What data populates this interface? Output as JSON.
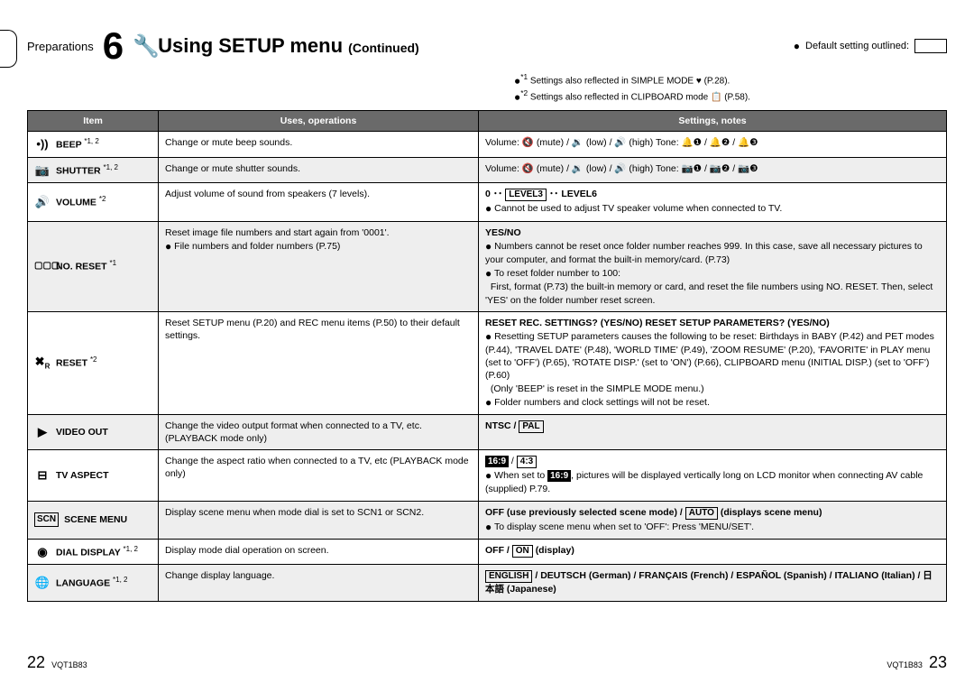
{
  "header": {
    "preparations": "Preparations",
    "number": "6",
    "title_main": "Using SETUP menu",
    "title_sub": "(Continued)",
    "default_setting": "Default setting outlined:"
  },
  "top_notes": {
    "n1_sup": "*1",
    "n1": "Settings also reflected in SIMPLE MODE ♥ (P.28).",
    "n2_sup": "*2",
    "n2": "Settings also reflected in CLIPBOARD mode 📋 (P.58)."
  },
  "columns": {
    "item": "Item",
    "uses": "Uses, operations",
    "settings": "Settings, notes"
  },
  "rows": {
    "beep": {
      "label": "BEEP",
      "sup": "*1, 2",
      "uses": "Change or mute beep sounds.",
      "settings": "Volume: 🔇 (mute) / 🔉 (low) / 🔊 (high)    Tone: 🔔❶ / 🔔❷ / 🔔❸"
    },
    "shutter": {
      "label": "SHUTTER",
      "sup": "*1, 2",
      "uses": "Change or mute shutter sounds.",
      "settings": "Volume: 🔇 (mute) / 🔉 (low) / 🔊 (high)    Tone: 📷❶ / 📷❷ / 📷❸"
    },
    "volume": {
      "label": "VOLUME",
      "sup": "*2",
      "uses": "Adjust volume of sound from speakers (7 levels).",
      "set_l": "0 ･･",
      "set_box": "LEVEL3",
      "set_r": "･･ LEVEL6",
      "bul": "Cannot be used to adjust TV speaker volume when connected to TV."
    },
    "noreset": {
      "label": "NO. RESET",
      "sup": "*1",
      "u1": "Reset image file numbers and start again from '0001'.",
      "u2": "File numbers and folder numbers (P.75)",
      "yesno": "YES/NO",
      "b1": "Numbers cannot be reset once folder number reaches 999. In this case, save all necessary pictures to your computer, and format the built-in memory/card. (P.73)",
      "b2": "To reset folder number to 100:",
      "b2a": "First, format (P.73) the built-in memory or card, and reset the file numbers using NO. RESET. Then, select 'YES' on the folder number reset screen."
    },
    "reset": {
      "label": "RESET",
      "sup": "*2",
      "uses": "Reset SETUP menu (P.20) and REC menu items (P.50) to their default settings.",
      "h": "RESET REC. SETTINGS? (YES/NO)    RESET SETUP PARAMETERS? (YES/NO)",
      "b1": "Resetting SETUP parameters causes the following to be reset: Birthdays in BABY (P.42) and PET modes (P.44), 'TRAVEL DATE' (P.48), 'WORLD TIME' (P.49), 'ZOOM RESUME' (P.20), 'FAVORITE' in PLAY menu (set to 'OFF') (P.65), 'ROTATE DISP.' (set to 'ON') (P.66), CLIPBOARD menu (INITIAL DISP.) (set to 'OFF') (P.60)",
      "b1a": "(Only 'BEEP' is reset in the SIMPLE MODE menu.)",
      "b2": "Folder numbers and clock settings will not be reset."
    },
    "videoout": {
      "label": "VIDEO OUT",
      "uses": "Change the video output format when connected to a TV, etc. (PLAYBACK mode only)",
      "set_l": "NTSC /",
      "set_box": "PAL"
    },
    "tvaspect": {
      "label": "TV ASPECT",
      "uses": "Change the aspect ratio when connected to a TV, etc (PLAYBACK mode only)",
      "a169": "16:9",
      "a43": "4:3",
      "b1a": "When set to ",
      "b1b": ", pictures will be displayed vertically long on LCD monitor when connecting AV cable (supplied) P.79."
    },
    "scene": {
      "label": "SCENE MENU",
      "uses": "Display scene menu when mode dial is set to SCN1 or SCN2.",
      "set_l": "OFF (use previously selected scene mode) /",
      "set_box": "AUTO",
      "set_r": "(displays scene menu)",
      "b1": "To display scene menu when set to 'OFF': Press 'MENU/SET'."
    },
    "dial": {
      "label": "DIAL DISPLAY",
      "sup": "*1, 2",
      "uses": "Display mode dial operation on screen.",
      "set_l": "OFF /",
      "set_box": "ON",
      "set_r": "(display)"
    },
    "lang": {
      "label": "LANGUAGE",
      "sup": "*1, 2",
      "uses": "Change display language.",
      "set_box": "ENGLISH",
      "set_r": " / DEUTSCH (German) / FRANÇAIS (French) / ESPAÑOL (Spanish) / ITALIANO (Italian) / 日本語 (Japanese)"
    }
  },
  "footer": {
    "left_pg": "22",
    "right_pg": "23",
    "code": "VQT1B83"
  }
}
